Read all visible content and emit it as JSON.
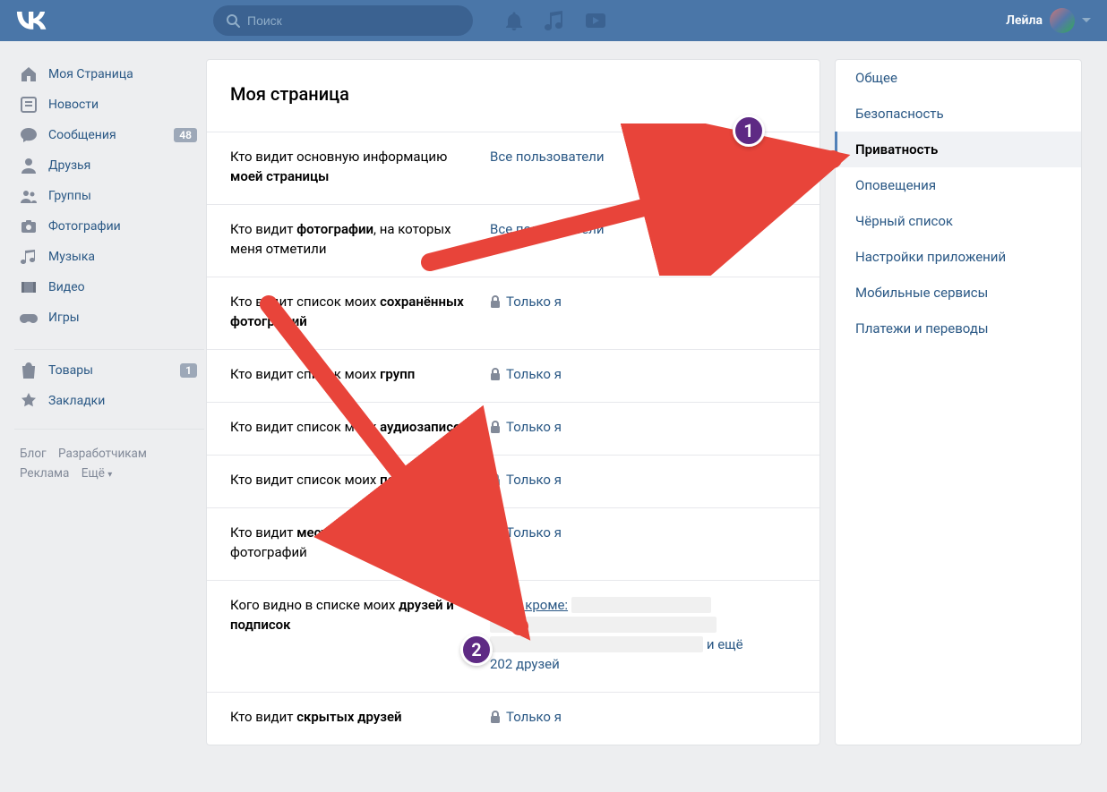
{
  "header": {
    "search_placeholder": "Поиск",
    "user_name": "Лейла"
  },
  "left_nav": {
    "items": [
      {
        "icon": "home-icon",
        "label": "Моя Страница"
      },
      {
        "icon": "news-icon",
        "label": "Новости"
      },
      {
        "icon": "messages-icon",
        "label": "Сообщения",
        "badge": "48"
      },
      {
        "icon": "friends-icon",
        "label": "Друзья"
      },
      {
        "icon": "groups-icon",
        "label": "Группы"
      },
      {
        "icon": "photos-icon",
        "label": "Фотографии"
      },
      {
        "icon": "music-icon",
        "label": "Музыка"
      },
      {
        "icon": "video-icon",
        "label": "Видео"
      },
      {
        "icon": "games-icon",
        "label": "Игры"
      }
    ],
    "secondary": [
      {
        "icon": "market-icon",
        "label": "Товары",
        "badge": "1"
      },
      {
        "icon": "bookmarks-icon",
        "label": "Закладки"
      }
    ],
    "footer": {
      "blog": "Блог",
      "devs": "Разработчикам",
      "ads": "Реклама",
      "more": "Ещё"
    }
  },
  "page_title": "Моя страница",
  "settings": [
    {
      "label_pre": "Кто видит основную информацию ",
      "label_bold": "моей страницы",
      "value": "Все пользователи",
      "lock": false
    },
    {
      "label_pre": "Кто видит ",
      "label_bold": "фотографии",
      "label_post": ", на которых меня отметили",
      "value": "Все пользователи",
      "lock": false
    },
    {
      "label_pre": "Кто видит список моих ",
      "label_bold": "сохранённых фотографий",
      "value": "Только я",
      "lock": true
    },
    {
      "label_pre": "Кто видит список моих ",
      "label_bold": "групп",
      "value": "Только я",
      "lock": true
    },
    {
      "label_pre": "Кто видит список моих ",
      "label_bold": "аудиозаписей",
      "value": "Только я",
      "lock": true
    },
    {
      "label_pre": "Кто видит список моих ",
      "label_bold": "подарков",
      "value": "Только я",
      "lock": true
    },
    {
      "label_pre": "Кто видит ",
      "label_bold": "местоположение",
      "label_post": " моих фотографий",
      "value": "Только я",
      "lock": true
    },
    {
      "label_pre": "Кого видно в списке моих ",
      "label_bold": "друзей и подписок",
      "value_link": "Всех, кроме:",
      "value_rest": " и ещё 202 друзей",
      "lock": false,
      "censored": true
    },
    {
      "label_pre": "Кто видит ",
      "label_bold": "скрытых друзей",
      "value": "Только я",
      "lock": true
    }
  ],
  "tabs": [
    {
      "label": "Общее"
    },
    {
      "label": "Безопасность"
    },
    {
      "label": "Приватность",
      "active": true
    },
    {
      "label": "Оповещения"
    },
    {
      "label": "Чёрный список"
    },
    {
      "label": "Настройки приложений"
    },
    {
      "label": "Мобильные сервисы"
    },
    {
      "label": "Платежи и переводы"
    }
  ],
  "annotations": {
    "step1": "1",
    "step2": "2"
  }
}
